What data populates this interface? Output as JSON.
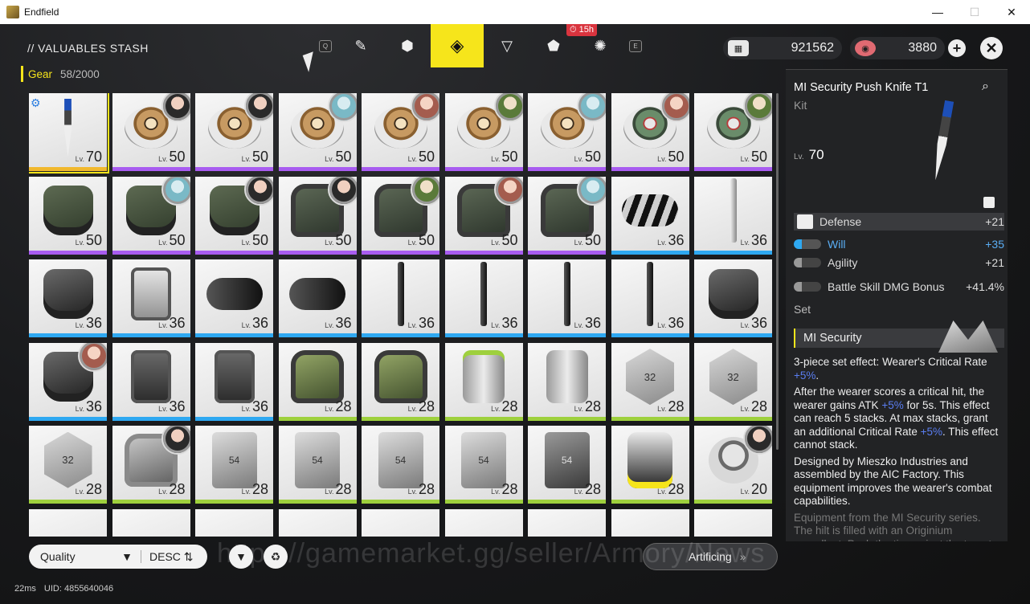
{
  "window": {
    "title": "Endfield",
    "minimize": "—",
    "maximize": "☐",
    "close": "✕"
  },
  "header": {
    "title": "// VALUABLES STASH",
    "tab_key_left": "Q",
    "tab_key_right": "E",
    "tab_badge": "15h",
    "tabs": [
      {
        "name": "tab-weapons",
        "glyph": "✎"
      },
      {
        "name": "tab-gear",
        "glyph": "⬢"
      },
      {
        "name": "tab-equipment",
        "glyph": "◈"
      },
      {
        "name": "tab-consumables",
        "glyph": "▽"
      },
      {
        "name": "tab-materials",
        "glyph": "⬟"
      },
      {
        "name": "tab-special",
        "glyph": "✺"
      }
    ],
    "currency1": {
      "icon": "▦",
      "value": "921562"
    },
    "currency2": {
      "icon": "◉",
      "value": "3880"
    },
    "plus": "+",
    "close": "✕"
  },
  "gear_tab": {
    "label": "Gear",
    "count": "58/2000"
  },
  "level_prefix": "Lv.",
  "items": [
    {
      "lv": "70",
      "rarity": "gold",
      "art": "knife",
      "owner": "",
      "selected": true,
      "tag": "⚙"
    },
    {
      "lv": "50",
      "rarity": "purple",
      "art": "disk",
      "owner": "o1"
    },
    {
      "lv": "50",
      "rarity": "purple",
      "art": "disk",
      "owner": "o1"
    },
    {
      "lv": "50",
      "rarity": "purple",
      "art": "disk",
      "owner": "o2"
    },
    {
      "lv": "50",
      "rarity": "purple",
      "art": "disk",
      "owner": "o3"
    },
    {
      "lv": "50",
      "rarity": "purple",
      "art": "disk",
      "owner": "o4"
    },
    {
      "lv": "50",
      "rarity": "purple",
      "art": "disk",
      "owner": "o2"
    },
    {
      "lv": "50",
      "rarity": "purple",
      "art": "disk green",
      "owner": "o3"
    },
    {
      "lv": "50",
      "rarity": "purple",
      "art": "disk green",
      "owner": "o4"
    },
    {
      "lv": "50",
      "rarity": "purple",
      "art": "glove",
      "owner": ""
    },
    {
      "lv": "50",
      "rarity": "purple",
      "art": "glove",
      "owner": "o2"
    },
    {
      "lv": "50",
      "rarity": "purple",
      "art": "glove",
      "owner": "o1"
    },
    {
      "lv": "50",
      "rarity": "purple",
      "art": "armor",
      "owner": "o1"
    },
    {
      "lv": "50",
      "rarity": "purple",
      "art": "armor",
      "owner": "o4"
    },
    {
      "lv": "50",
      "rarity": "purple",
      "art": "armor",
      "owner": "o3"
    },
    {
      "lv": "50",
      "rarity": "purple",
      "art": "armor",
      "owner": "o2"
    },
    {
      "lv": "36",
      "rarity": "blue",
      "art": "cyl",
      "owner": ""
    },
    {
      "lv": "36",
      "rarity": "blue",
      "art": "tool light",
      "owner": ""
    },
    {
      "lv": "36",
      "rarity": "blue",
      "art": "glove dark",
      "owner": ""
    },
    {
      "lv": "36",
      "rarity": "blue",
      "art": "vest",
      "owner": ""
    },
    {
      "lv": "36",
      "rarity": "blue",
      "art": "cyl black",
      "owner": ""
    },
    {
      "lv": "36",
      "rarity": "blue",
      "art": "cyl black",
      "owner": ""
    },
    {
      "lv": "36",
      "rarity": "blue",
      "art": "tool",
      "owner": ""
    },
    {
      "lv": "36",
      "rarity": "blue",
      "art": "tool",
      "owner": ""
    },
    {
      "lv": "36",
      "rarity": "blue",
      "art": "tool",
      "owner": ""
    },
    {
      "lv": "36",
      "rarity": "blue",
      "art": "tool",
      "owner": ""
    },
    {
      "lv": "36",
      "rarity": "blue",
      "art": "glove dark",
      "owner": ""
    },
    {
      "lv": "36",
      "rarity": "blue",
      "art": "glove dark",
      "owner": "o3"
    },
    {
      "lv": "36",
      "rarity": "blue",
      "art": "vest dark",
      "owner": ""
    },
    {
      "lv": "36",
      "rarity": "blue",
      "art": "vest dark",
      "owner": ""
    },
    {
      "lv": "28",
      "rarity": "green",
      "art": "armor olive",
      "owner": ""
    },
    {
      "lv": "28",
      "rarity": "green",
      "art": "armor olive",
      "owner": ""
    },
    {
      "lv": "28",
      "rarity": "green",
      "art": "canister green",
      "owner": ""
    },
    {
      "lv": "28",
      "rarity": "green",
      "art": "canister",
      "owner": ""
    },
    {
      "lv": "28",
      "rarity": "green",
      "art": "hex",
      "text": "32",
      "owner": ""
    },
    {
      "lv": "28",
      "rarity": "green",
      "art": "hex",
      "text": "32",
      "owner": ""
    },
    {
      "lv": "28",
      "rarity": "green",
      "art": "hex",
      "text": "32",
      "owner": ""
    },
    {
      "lv": "28",
      "rarity": "green",
      "art": "armor grey",
      "owner": "o1"
    },
    {
      "lv": "28",
      "rarity": "green",
      "art": "plate",
      "text": "54",
      "owner": ""
    },
    {
      "lv": "28",
      "rarity": "green",
      "art": "plate",
      "text": "54",
      "owner": ""
    },
    {
      "lv": "28",
      "rarity": "green",
      "art": "plate",
      "text": "54",
      "owner": ""
    },
    {
      "lv": "28",
      "rarity": "green",
      "art": "plate",
      "text": "54",
      "owner": ""
    },
    {
      "lv": "28",
      "rarity": "green",
      "art": "plate dark",
      "text": "54",
      "owner": ""
    },
    {
      "lv": "28",
      "rarity": "green",
      "art": "suit",
      "owner": ""
    },
    {
      "lv": "20",
      "rarity": "green",
      "art": "dome",
      "owner": "o1"
    }
  ],
  "detail": {
    "name": "MI Security Push Knife T1",
    "kind": "Kit",
    "level": "70",
    "stats": [
      {
        "label": "Defense",
        "value": "+21"
      },
      {
        "label": "Will",
        "value": "+35"
      },
      {
        "label": "Agility",
        "value": "+21"
      },
      {
        "label": "Battle Skill DMG Bonus",
        "value": "+41.4%"
      }
    ],
    "set_label": "Set",
    "set_name": "MI Security",
    "set_effect_a": "3-piece set effect: Wearer's Critical Rate ",
    "set_effect_a_hl": "+5%",
    "set_effect_a_end": ".",
    "effect_b1": "After the wearer scores a critical hit, the wearer gains ATK ",
    "effect_b_hl1": "+5%",
    "effect_b2": " for 5s. This effect can reach 5 stacks. At max stacks, grant an additional Critical Rate ",
    "effect_b_hl2": "+5%",
    "effect_b3": ". This effect cannot stack.",
    "design": "Designed by Mieszko Industries and assembled by the AIC Factory. This equipment improves the wearer's combat capabilities.",
    "flavor": "Equipment from the MI Security series. The hilt is filled with an Originium propellant. Push the tip against the target and squeeze the trigger to fire."
  },
  "bottom": {
    "sort_field": "Quality",
    "sort_dir": "DESC",
    "artificing": "Artificing",
    "watermark": "https://gamemarket.gg/seller/Armory/News"
  },
  "status": {
    "ping": "22ms",
    "uid": "UID: 4855640046"
  }
}
